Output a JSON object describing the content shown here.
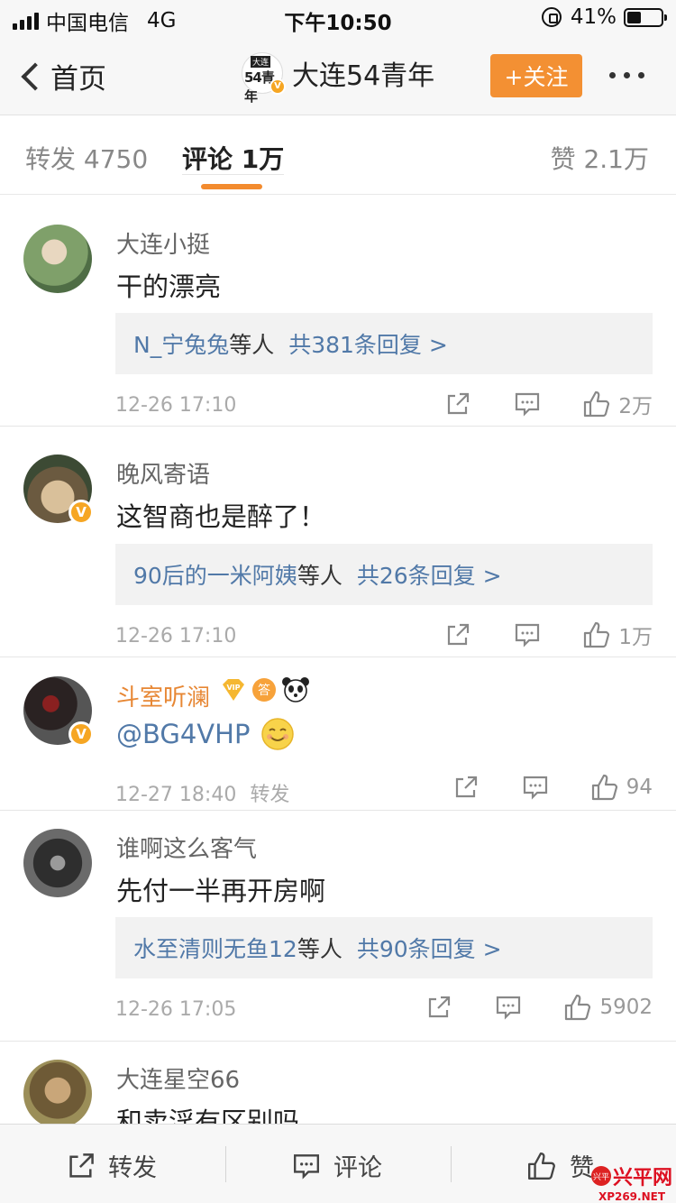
{
  "status_bar": {
    "carrier": "中国电信",
    "network": "4G",
    "time": "下午10:50",
    "battery": "41%",
    "battery_level": 0.41
  },
  "nav": {
    "back_label": "首页",
    "avatar_top": "大连",
    "avatar_main": "54青年",
    "verified_badge": "V",
    "title": "大连54青年",
    "follow_label": "+关注"
  },
  "tabs": {
    "repost": "转发 4750",
    "comment": "评论 1万",
    "like": "赞 2.1万"
  },
  "comments": [
    {
      "name": "大连小挺",
      "text": "干的漂亮",
      "reply_users": "N_宁兔兔",
      "reply_etc": "等人",
      "reply_total": "共381条回复 >",
      "time": "12-26 17:10",
      "likes": "2万",
      "avatar_color": "#6a8c58"
    },
    {
      "name": "晚风寄语",
      "text": "这智商也是醉了！",
      "reply_users": "90后的一米阿姨",
      "reply_etc": "等人",
      "reply_total": "共26条回复 >",
      "time": "12-26 17:10",
      "likes": "1万",
      "avatar_color": "#8a7a60"
    },
    {
      "name": "斗室听澜",
      "text": "@BG4VHP",
      "time": "12-27 18:40",
      "time_tag": "转发",
      "likes": "94",
      "avatar_color": "#3c3030",
      "badge_vip": "VIP",
      "badge_answer": "答"
    },
    {
      "name": "谁啊这么客气",
      "text": "先付一半再开房啊",
      "reply_users": "水至清则无鱼12",
      "reply_etc": "等人",
      "reply_total": "共90条回复 >",
      "time": "12-26 17:05",
      "likes": "5902",
      "avatar_color": "#585858"
    },
    {
      "name": "大连星空66",
      "text": "和卖淫有区别吗",
      "avatar_color": "#8c7e52"
    }
  ],
  "bottom_bar": {
    "repost": "转发",
    "comment": "评论",
    "like": "赞"
  },
  "watermark": {
    "logo": "兴平",
    "text": "兴平网",
    "url": "XP269.NET"
  },
  "icons": [
    "signal-icon",
    "lock-rotation-icon",
    "battery-icon",
    "back-chevron-icon",
    "more-icon",
    "verified-icon",
    "share-icon",
    "comment-icon",
    "thumbs-up-icon",
    "vip-icon",
    "answer-icon",
    "panda-icon",
    "smiley-icon"
  ],
  "colors": {
    "accent": "#f39033",
    "link": "#5179a8",
    "gold_name": "#e78734"
  }
}
